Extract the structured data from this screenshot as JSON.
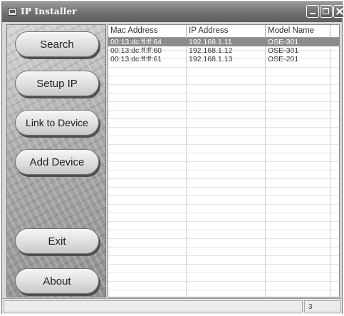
{
  "window": {
    "title": "IP Installer"
  },
  "sidebar": {
    "buttons": [
      {
        "label": "Search"
      },
      {
        "label": "Setup IP"
      },
      {
        "label": "Link to Device"
      },
      {
        "label": "Add Device"
      },
      {
        "label": "Exit"
      },
      {
        "label": "About"
      }
    ]
  },
  "list": {
    "columns": [
      "Mac Address",
      "IP Address",
      "Model Name"
    ],
    "rows": [
      {
        "mac": "00:13:dc:ff:ff:64",
        "ip": "192.168.1.11",
        "model": "OSE-301",
        "selected": true
      },
      {
        "mac": "00:13:dc:ff:ff:60",
        "ip": "192.168.1.12",
        "model": "OSE-301",
        "selected": false
      },
      {
        "mac": "00:13:dc:ff:ff:61",
        "ip": "192.168.1.13",
        "model": "OSE-201",
        "selected": false
      }
    ]
  },
  "statusbar": {
    "message": "",
    "count": "3"
  },
  "colors": {
    "selection": "#8c8c8c",
    "titlebar": "#6f6f6f"
  }
}
